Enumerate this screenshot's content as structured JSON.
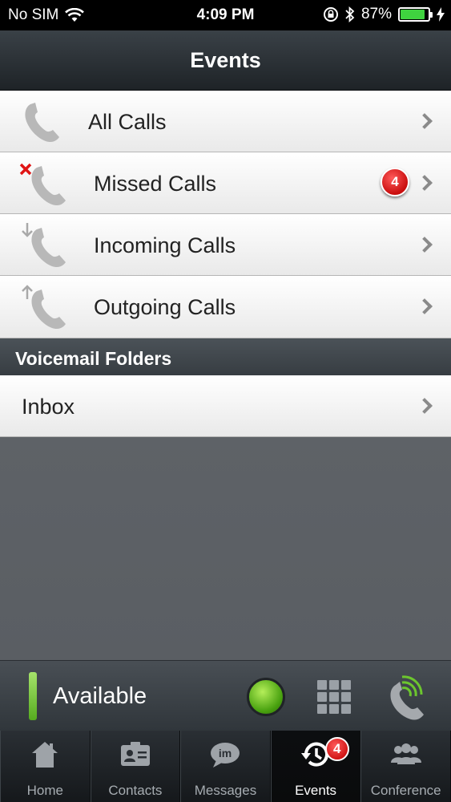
{
  "status_bar": {
    "carrier": "No SIM",
    "time": "4:09 PM",
    "battery_percent": "87%",
    "battery_level": 0.87
  },
  "nav": {
    "title": "Events"
  },
  "event_rows": [
    {
      "label": "All Calls",
      "icon": "phone-icon"
    },
    {
      "label": "Missed Calls",
      "icon": "missed-call-icon",
      "badge": "4"
    },
    {
      "label": "Incoming Calls",
      "icon": "incoming-call-icon"
    },
    {
      "label": "Outgoing Calls",
      "icon": "outgoing-call-icon"
    }
  ],
  "voicemail": {
    "header": "Voicemail Folders",
    "folders": [
      {
        "label": "Inbox"
      }
    ]
  },
  "presence": {
    "status": "Available",
    "color": "#6cc62e"
  },
  "tabs": [
    {
      "label": "Home",
      "icon": "home-icon"
    },
    {
      "label": "Contacts",
      "icon": "contacts-icon"
    },
    {
      "label": "Messages",
      "icon": "messages-icon",
      "icon_text": "im"
    },
    {
      "label": "Events",
      "icon": "events-history-icon",
      "badge": "4",
      "active": true
    },
    {
      "label": "Conference",
      "icon": "conference-icon"
    }
  ],
  "colors": {
    "badge_red": "#d11616",
    "accent_green": "#6cc62e"
  }
}
